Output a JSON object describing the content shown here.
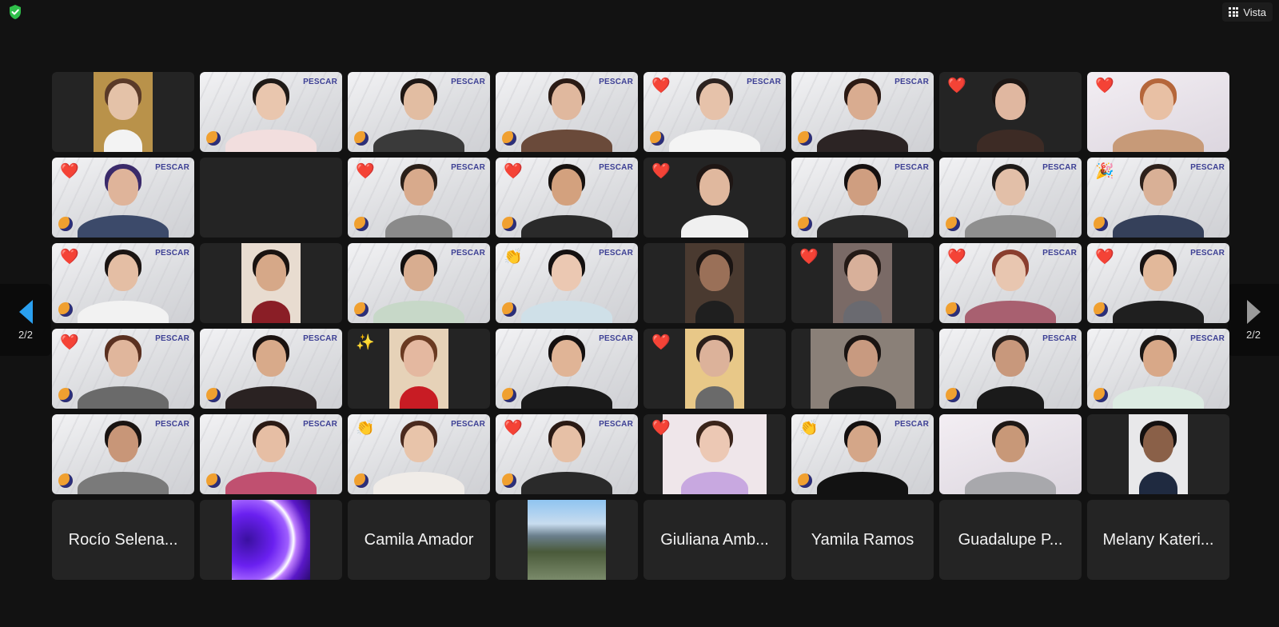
{
  "toolbar": {
    "view_label": "Vista",
    "view_icon": "grid-icon",
    "security_icon": "shield-check-icon",
    "security_color": "#2fbf4a"
  },
  "navigation": {
    "prev_page": "2/2",
    "next_page": "2/2",
    "prev_color": "#2aa0f0",
    "next_color": "#9a9a9a"
  },
  "tiles": [
    {
      "type": "video",
      "bg": "dark",
      "vw": 74,
      "skin": "#e4c2a8",
      "hair": "#5a3a28",
      "shirt": "#f3f3f3",
      "scene": "#b9924a"
    },
    {
      "type": "video",
      "bg": "pescar",
      "vw": 178,
      "skin": "#e9c6ae",
      "hair": "#1f1a17",
      "shirt": "#f2dede",
      "logo": "PESCAR"
    },
    {
      "type": "video",
      "bg": "pescar",
      "vw": 178,
      "skin": "#e2bda2",
      "hair": "#1e1714",
      "shirt": "#3a3a3a",
      "logo": "PESCAR"
    },
    {
      "type": "video",
      "bg": "pescar",
      "vw": 178,
      "skin": "#e0b89e",
      "hair": "#2a1b15",
      "shirt": "#6a4a3a",
      "logo": "PESCAR"
    },
    {
      "type": "video",
      "bg": "pescar",
      "vw": 178,
      "skin": "#e6c2aa",
      "hair": "#2d2320",
      "shirt": "#f4f4f4",
      "logo": "PESCAR",
      "reaction": "❤️"
    },
    {
      "type": "video",
      "bg": "pescar",
      "vw": 178,
      "skin": "#d9ac90",
      "hair": "#2b1a14",
      "shirt": "#2c2424",
      "logo": "PESCAR"
    },
    {
      "type": "video",
      "bg": "dark",
      "vw": 130,
      "skin": "#e0b7a0",
      "hair": "#1c1614",
      "shirt": "#3d2b25",
      "reaction": "❤️"
    },
    {
      "type": "video",
      "bg": "light",
      "vw": 178,
      "skin": "#e8c0a4",
      "hair": "#b5663a",
      "shirt": "#c79a78",
      "reaction": "❤️"
    },
    {
      "type": "video",
      "bg": "pescar",
      "vw": 178,
      "skin": "#dfb49a",
      "hair": "#3a2a6a",
      "shirt": "#3c4a6a",
      "logo": "PESCAR",
      "reaction": "❤️"
    },
    {
      "type": "empty"
    },
    {
      "type": "video",
      "bg": "pescar",
      "vw": 130,
      "skin": "#d8aa8c",
      "hair": "#2a1f18",
      "shirt": "#8a8a8a",
      "logo": "PESCAR",
      "reaction": "❤️"
    },
    {
      "type": "video",
      "bg": "pescar",
      "vw": 178,
      "skin": "#d3a17e",
      "hair": "#171210",
      "shirt": "#2a2a2a",
      "logo": "PESCAR",
      "reaction": "❤️"
    },
    {
      "type": "video",
      "bg": "dark",
      "vw": 130,
      "skin": "#e0b89e",
      "hair": "#1e1614",
      "shirt": "#f0f0f0",
      "reaction": "❤️"
    },
    {
      "type": "video",
      "bg": "pescar",
      "vw": 178,
      "skin": "#cf9e80",
      "hair": "#151010",
      "shirt": "#2a2a2a",
      "logo": "PESCAR"
    },
    {
      "type": "video",
      "bg": "pescar",
      "vw": 178,
      "skin": "#e2bfa8",
      "hair": "#1e1a18",
      "shirt": "#8f8f8f",
      "logo": "PESCAR"
    },
    {
      "type": "video",
      "bg": "pescar",
      "vw": 178,
      "skin": "#d9b096",
      "hair": "#2d201a",
      "shirt": "#35405a",
      "logo": "PESCAR",
      "reaction": "🎉"
    },
    {
      "type": "video",
      "bg": "pescar",
      "vw": 178,
      "skin": "#e4bea4",
      "hair": "#1b1513",
      "shirt": "#f2f2f2",
      "logo": "PESCAR",
      "reaction": "❤️"
    },
    {
      "type": "video",
      "bg": "dark",
      "vw": 74,
      "skin": "#d6a888",
      "hair": "#1a1310",
      "shirt": "#8a1e26",
      "scene": "#e8dcd0"
    },
    {
      "type": "video",
      "bg": "pescar",
      "vw": 178,
      "skin": "#d8ad90",
      "hair": "#121010",
      "shirt": "#c7d8c8",
      "logo": "PESCAR"
    },
    {
      "type": "video",
      "bg": "pescar",
      "vw": 178,
      "skin": "#ebc8b2",
      "hair": "#141010",
      "shirt": "#cfe0e8",
      "logo": "PESCAR",
      "reaction": "👏"
    },
    {
      "type": "video",
      "bg": "dark",
      "vw": 74,
      "skin": "#9a7058",
      "hair": "#1a1412",
      "shirt": "#1f1f1f",
      "scene": "#4a3a30"
    },
    {
      "type": "video",
      "bg": "dark",
      "vw": 74,
      "skin": "#d8b09a",
      "hair": "#241a16",
      "shirt": "#6a6a70",
      "scene": "#7a6a66",
      "reaction": "❤️"
    },
    {
      "type": "video",
      "bg": "pescar",
      "vw": 178,
      "skin": "#e8c6b0",
      "hair": "#8a3e2e",
      "shirt": "#a86070",
      "logo": "PESCAR",
      "reaction": "❤️"
    },
    {
      "type": "video",
      "bg": "pescar",
      "vw": 178,
      "skin": "#e2b89a",
      "hair": "#181212",
      "shirt": "#1f1f1f",
      "logo": "PESCAR",
      "reaction": "❤️"
    },
    {
      "type": "video",
      "bg": "pescar",
      "vw": 178,
      "skin": "#e0b69c",
      "hair": "#5a3020",
      "shirt": "#6a6a6a",
      "logo": "PESCAR",
      "reaction": "❤️"
    },
    {
      "type": "video",
      "bg": "pescar",
      "vw": 178,
      "skin": "#d8aa8a",
      "hair": "#1a1210",
      "shirt": "#2a2222",
      "logo": "PESCAR"
    },
    {
      "type": "video",
      "bg": "dark",
      "vw": 74,
      "skin": "#e4b8a0",
      "hair": "#6a3a22",
      "shirt": "#c81c24",
      "scene": "#e6d2b8",
      "reaction": "✨"
    },
    {
      "type": "video",
      "bg": "pescar",
      "vw": 178,
      "skin": "#e0b496",
      "hair": "#141010",
      "shirt": "#1a1a1a",
      "logo": "PESCAR"
    },
    {
      "type": "video",
      "bg": "dark",
      "vw": 74,
      "skin": "#dcb29a",
      "hair": "#2a1e1a",
      "shirt": "#6a6a6a",
      "scene": "#e8c888",
      "reaction": "❤️"
    },
    {
      "type": "video",
      "bg": "dark",
      "vw": 130,
      "skin": "#c89a80",
      "hair": "#1a1412",
      "shirt": "#1c1c1c",
      "scene": "#8a8078"
    },
    {
      "type": "video",
      "bg": "pescar",
      "vw": 130,
      "skin": "#c8987c",
      "hair": "#2a201c",
      "shirt": "#1a1a1a",
      "logo": "PESCAR"
    },
    {
      "type": "video",
      "bg": "pescar",
      "vw": 178,
      "skin": "#d8a888",
      "hair": "#1a1614",
      "shirt": "#dcebe2",
      "logo": "PESCAR"
    },
    {
      "type": "video",
      "bg": "pescar",
      "vw": 178,
      "skin": "#c89678",
      "hair": "#1a1412",
      "shirt": "#7a7a7a",
      "logo": "PESCAR"
    },
    {
      "type": "video",
      "bg": "pescar",
      "vw": 178,
      "skin": "#e6bea4",
      "hair": "#2a1a14",
      "shirt": "#c05070",
      "logo": "PESCAR"
    },
    {
      "type": "video",
      "bg": "pescar",
      "vw": 178,
      "skin": "#e8c4aa",
      "hair": "#4a2a1e",
      "shirt": "#f0ece8",
      "logo": "PESCAR",
      "reaction": "👏"
    },
    {
      "type": "video",
      "bg": "pescar",
      "vw": 178,
      "skin": "#e6c0a6",
      "hair": "#2a1a14",
      "shirt": "#2a2a2a",
      "logo": "PESCAR",
      "reaction": "❤️"
    },
    {
      "type": "video",
      "bg": "dark",
      "vw": 130,
      "skin": "#ecc8b4",
      "hair": "#3a241a",
      "shirt": "#c8a8e0",
      "scene": "#efe6ea",
      "reaction": "❤️"
    },
    {
      "type": "video",
      "bg": "pescar",
      "vw": 178,
      "skin": "#d4a688",
      "hair": "#141010",
      "shirt": "#121212",
      "logo": "PESCAR",
      "reaction": "👏"
    },
    {
      "type": "video",
      "bg": "light",
      "vw": 178,
      "skin": "#c89878",
      "hair": "#1e1816",
      "shirt": "#a8a8ac"
    },
    {
      "type": "video",
      "bg": "dark",
      "vw": 74,
      "skin": "#8a6048",
      "hair": "#141010",
      "shirt": "#1f2a40",
      "scene": "#e8e8ea"
    },
    {
      "type": "name",
      "name": "Rocío Selena..."
    },
    {
      "type": "avatar",
      "vw": 98,
      "gradient": "radial-gradient(circle at 20% 50%, #3a10a0 0%, #6a20f0 35%, #a060ff 55%, #ffffff 62%, #c080ff 66%, #5a18c8 80%, #2a0a70 100%)"
    },
    {
      "type": "name",
      "name": "Camila Amador"
    },
    {
      "type": "avatar",
      "vw": 98,
      "gradient": "linear-gradient(180deg,#8fc4f0 0%,#c8dcef 30%,#6a7f8c 45%,#4a5a3a 65%,#7a8a6a 100%)"
    },
    {
      "type": "name",
      "name": "Giuliana Amb..."
    },
    {
      "type": "name",
      "name": "Yamila Ramos"
    },
    {
      "type": "name",
      "name": "Guadalupe P..."
    },
    {
      "type": "name",
      "name": "Melany Kateri..."
    }
  ]
}
